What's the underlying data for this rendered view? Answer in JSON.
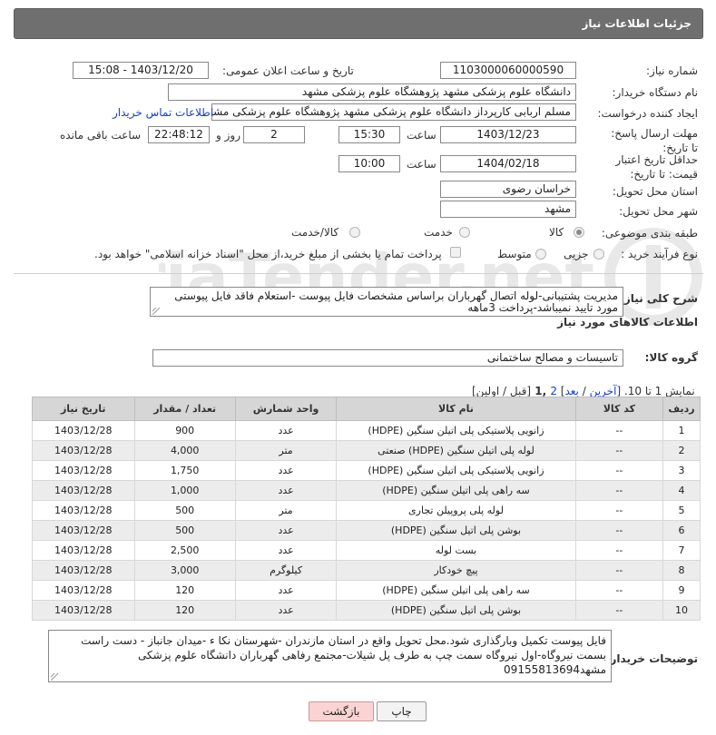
{
  "header": {
    "title": "جزئیات اطلاعات نیاز"
  },
  "fields": {
    "need_number_label": "شماره نیاز:",
    "need_number": "1103000060000590",
    "announce_label": "تاریخ و ساعت اعلان عمومی:",
    "announce_value": "1403/12/20 - 15:08",
    "buyer_org_label": "نام دستگاه خریدار:",
    "buyer_org": "دانشگاه علوم پزشکی مشهد   پژوهشگاه علوم پزشکی مشهد",
    "requester_label": "ایجاد کننده درخواست:",
    "requester": "مسلم اربابی کارپرداز دانشگاه علوم پزشکی مشهد   پژوهشگاه علوم پزشکی مشهد",
    "buyer_contact_link": "اطلاعات تماس خریدار",
    "deadline_label": "مهلت ارسال پاسخ: تا تاریخ:",
    "deadline_date": "1403/12/23",
    "time_label": "ساعت",
    "deadline_time": "15:30",
    "days_value": "2",
    "days_label": "روز و",
    "remaining_time": "22:48:12",
    "remaining_label": "ساعت باقی مانده",
    "validity_label": "حداقل تاریخ اعتبار قیمت: تا تاریخ:",
    "validity_date": "1404/02/18",
    "validity_time": "10:00",
    "province_label": "استان محل تحویل:",
    "province": "خراسان رضوی",
    "city_label": "شهر محل تحویل:",
    "city": "مشهد",
    "category_label": "طبقه بندی موضوعی:",
    "category_options": [
      "کالا",
      "خدمت",
      "کالا/خدمت"
    ],
    "category_selected": "کالا",
    "process_label": "نوع فرآیند خرید :",
    "process_options": [
      "جزیی",
      "متوسط"
    ],
    "payment_note": "پرداخت تمام یا بخشی از مبلغ خرید،از محل \"اسناد خزانه اسلامی\" خواهد بود."
  },
  "summary": {
    "label": "شرح کلی نیاز:",
    "text": "مدیریت پشتیبانی-لوله اتصال گهرباران براساس مشخصات فایل پیوست -استعلام فاقد فایل پیوستی مورد تایید نمیباشد-پرداخت 3ماهه"
  },
  "goods_section_title": "اطلاعات کالاهای مورد نیاز",
  "goods_group": {
    "label": "گروه کالا:",
    "value": "تاسیسات و مصالح ساختمانی"
  },
  "pagination": {
    "text_prefix": "نمایش 1 تا 10. [",
    "last": "آخرین",
    "sep1": " / ",
    "next": "بعد",
    "sep2": "] ",
    "page2": "2",
    "current": " ,1 ",
    "text_suffix": "[قبل / اولین]"
  },
  "table": {
    "headers": [
      "ردیف",
      "کد کالا",
      "نام کالا",
      "واحد شمارش",
      "تعداد / مقدار",
      "تاریخ نیاز"
    ],
    "rows": [
      [
        "1",
        "--",
        "زانویی پلاستیکی پلی اتیلن سنگین (HDPE)",
        "عدد",
        "900",
        "1403/12/28"
      ],
      [
        "2",
        "--",
        "لوله پلی اتیلن سنگین (HDPE) صنعتی",
        "متر",
        "4,000",
        "1403/12/28"
      ],
      [
        "3",
        "--",
        "زانویی پلاستیکی پلی اتیلن سنگین (HDPE)",
        "عدد",
        "1,750",
        "1403/12/28"
      ],
      [
        "4",
        "--",
        "سه راهی پلی اتیلن سنگین (HDPE)",
        "عدد",
        "1,000",
        "1403/12/28"
      ],
      [
        "5",
        "--",
        "لوله پلی پروپیلن تجاری",
        "متر",
        "500",
        "1403/12/28"
      ],
      [
        "6",
        "--",
        "بوشن پلی اتیل سنگین (HDPE)",
        "عدد",
        "500",
        "1403/12/28"
      ],
      [
        "7",
        "--",
        "بست لوله",
        "عدد",
        "2,500",
        "1403/12/28"
      ],
      [
        "8",
        "--",
        "پیچ خودکار",
        "کیلوگرم",
        "3,000",
        "1403/12/28"
      ],
      [
        "9",
        "--",
        "سه راهی پلی اتیلن سنگین (HDPE)",
        "عدد",
        "120",
        "1403/12/28"
      ],
      [
        "10",
        "--",
        "بوشن پلی اتیل سنگین (HDPE)",
        "عدد",
        "120",
        "1403/12/28"
      ]
    ]
  },
  "buyer_notes": {
    "label": "توضیحات خریدار:",
    "text": "فایل پیوست تکمیل وبارگذاری شود.محل تحویل واقع در استان مازندران -شهرستان نکا ء -میدان جانباز - دست راست بسمت نیروگاه-اول نیروگاه سمت چپ به طرف پل شیلات-مجتمع رفاهی گهرباران دانشگاه علوم پزشکی مشهد09155813694"
  },
  "buttons": {
    "print": "چاپ",
    "back": "بازگشت"
  },
  "watermark": {
    "brand": "AriaTender.net"
  },
  "colors": {
    "header_bg": "#6f6f6f",
    "link": "#1a3fbf",
    "back_button": "#fbd3d3",
    "table_header": "#d6d6d6"
  }
}
